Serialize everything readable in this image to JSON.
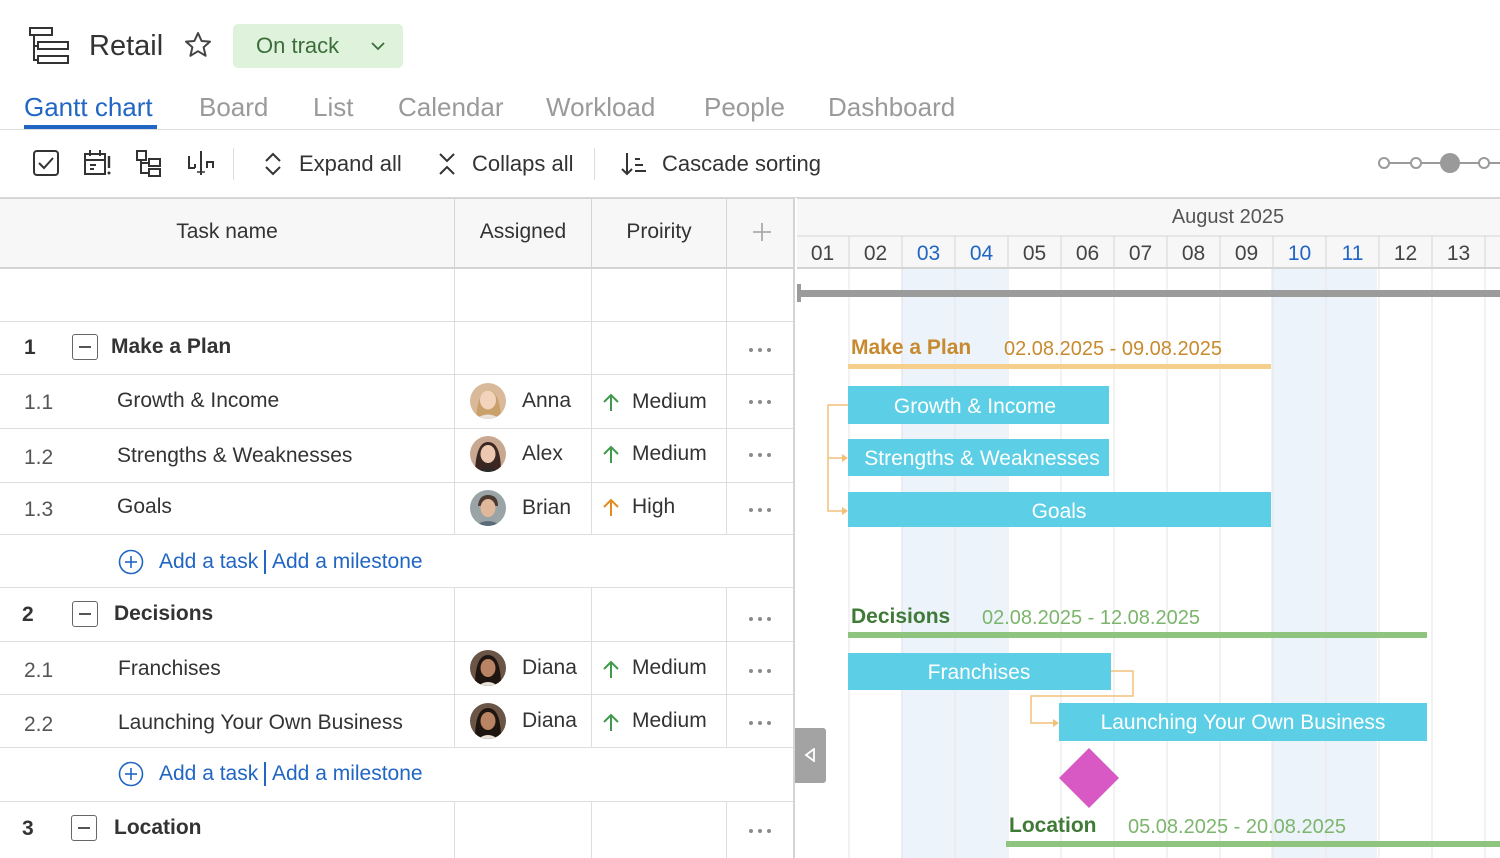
{
  "project": {
    "title": "Retail",
    "status": "On track",
    "icon": "gantt-project-icon",
    "star_icon": "star-icon"
  },
  "tabs": [
    {
      "label": "Gantt chart",
      "active": true
    },
    {
      "label": "Board",
      "active": false
    },
    {
      "label": "List",
      "active": false
    },
    {
      "label": "Calendar",
      "active": false
    },
    {
      "label": "Workload",
      "active": false
    },
    {
      "label": "People",
      "active": false
    },
    {
      "label": "Dashboard",
      "active": false
    }
  ],
  "toolbar": {
    "expand_all": "Expand all",
    "collapse_all": "Collaps all",
    "cascade_sorting": "Cascade sorting"
  },
  "grid": {
    "columns": {
      "task_name": "Task name",
      "assigned": "Assigned",
      "priority": "Proirity"
    },
    "add_task": "Add a task",
    "add_milestone": "Add a milestone",
    "groups": [
      {
        "num": "1",
        "name": "Make a Plan",
        "tasks": [
          {
            "num": "1.1",
            "name": "Growth & Income",
            "assignee": "Anna",
            "priority": "Medium"
          },
          {
            "num": "1.2",
            "name": "Strengths & Weaknesses",
            "assignee": "Alex",
            "priority": "Medium"
          },
          {
            "num": "1.3",
            "name": "Goals",
            "assignee": "Brian",
            "priority": "High"
          }
        ]
      },
      {
        "num": "2",
        "name": "Decisions",
        "tasks": [
          {
            "num": "2.1",
            "name": "Franchises",
            "assignee": "Diana",
            "priority": "Medium"
          },
          {
            "num": "2.2",
            "name": "Launching Your Own Business",
            "assignee": "Diana",
            "priority": "Medium"
          }
        ]
      },
      {
        "num": "3",
        "name": "Location",
        "tasks": []
      }
    ]
  },
  "timeline": {
    "month": "August 2025",
    "days": [
      "01",
      "02",
      "03",
      "04",
      "05",
      "06",
      "07",
      "08",
      "09",
      "10",
      "11",
      "12",
      "13"
    ],
    "weekend_days": [
      "03",
      "04",
      "10",
      "11"
    ],
    "groups": [
      {
        "name": "Make a Plan",
        "range": "02.08.2025 - 09.08.2025",
        "color": "#c88a2e"
      },
      {
        "name": "Decisions",
        "range": "02.08.2025 - 12.08.2025",
        "color": "#3f7a36"
      },
      {
        "name": "Location",
        "range": "05.08.2025 - 20.08.2025",
        "color": "#3f7a36"
      }
    ],
    "bars": [
      "Growth & Income",
      "Strengths & Weaknesses",
      "Goals",
      "Franchises",
      "Launching Your Own Business"
    ],
    "colors": {
      "bar": "#5ccfe6",
      "plan_summary": "#f7cf8c",
      "decisions_summary": "#8fc47f",
      "milestone": "#d859c4",
      "weekend": "#edf3fb"
    }
  }
}
